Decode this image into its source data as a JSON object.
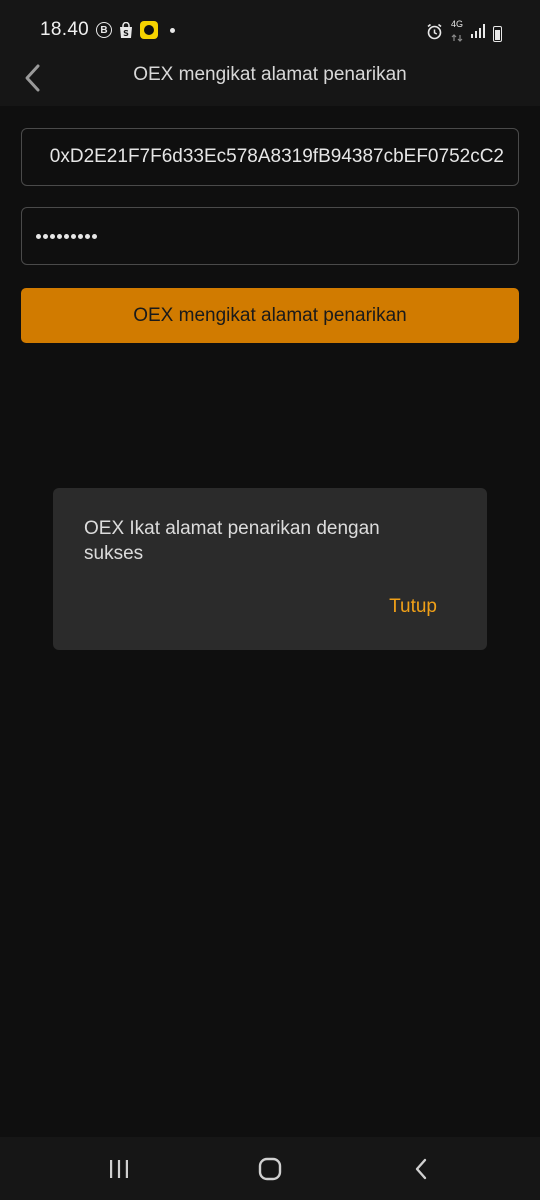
{
  "status_bar": {
    "time": "18.40",
    "b_badge": "B",
    "network": "4G",
    "icons": [
      "circle-b-icon",
      "shopping-bag-icon",
      "camera-app-icon",
      "notification-dot-icon",
      "alarm-icon",
      "data-arrows-icon",
      "signal-icon",
      "battery-icon"
    ]
  },
  "header": {
    "title": "OEX mengikat alamat penarikan",
    "back_icon": "chevron-left-icon"
  },
  "form": {
    "address_value": "0xD2E21F7F6d33Ec578A8319fB94387cbEF0752cC2",
    "password_dot_count": 9,
    "submit_label": "OEX mengikat alamat penarikan"
  },
  "dialog": {
    "message": "OEX Ikat alamat penarikan dengan sukses",
    "close_label": "Tutup"
  },
  "nav": {
    "icons": [
      "recent-apps-icon",
      "home-icon",
      "back-icon"
    ]
  },
  "colors": {
    "accent": "#d17b00",
    "dialog_action": "#f0a018",
    "background": "#0f0f0f",
    "dialog_bg": "#2b2b2b"
  }
}
